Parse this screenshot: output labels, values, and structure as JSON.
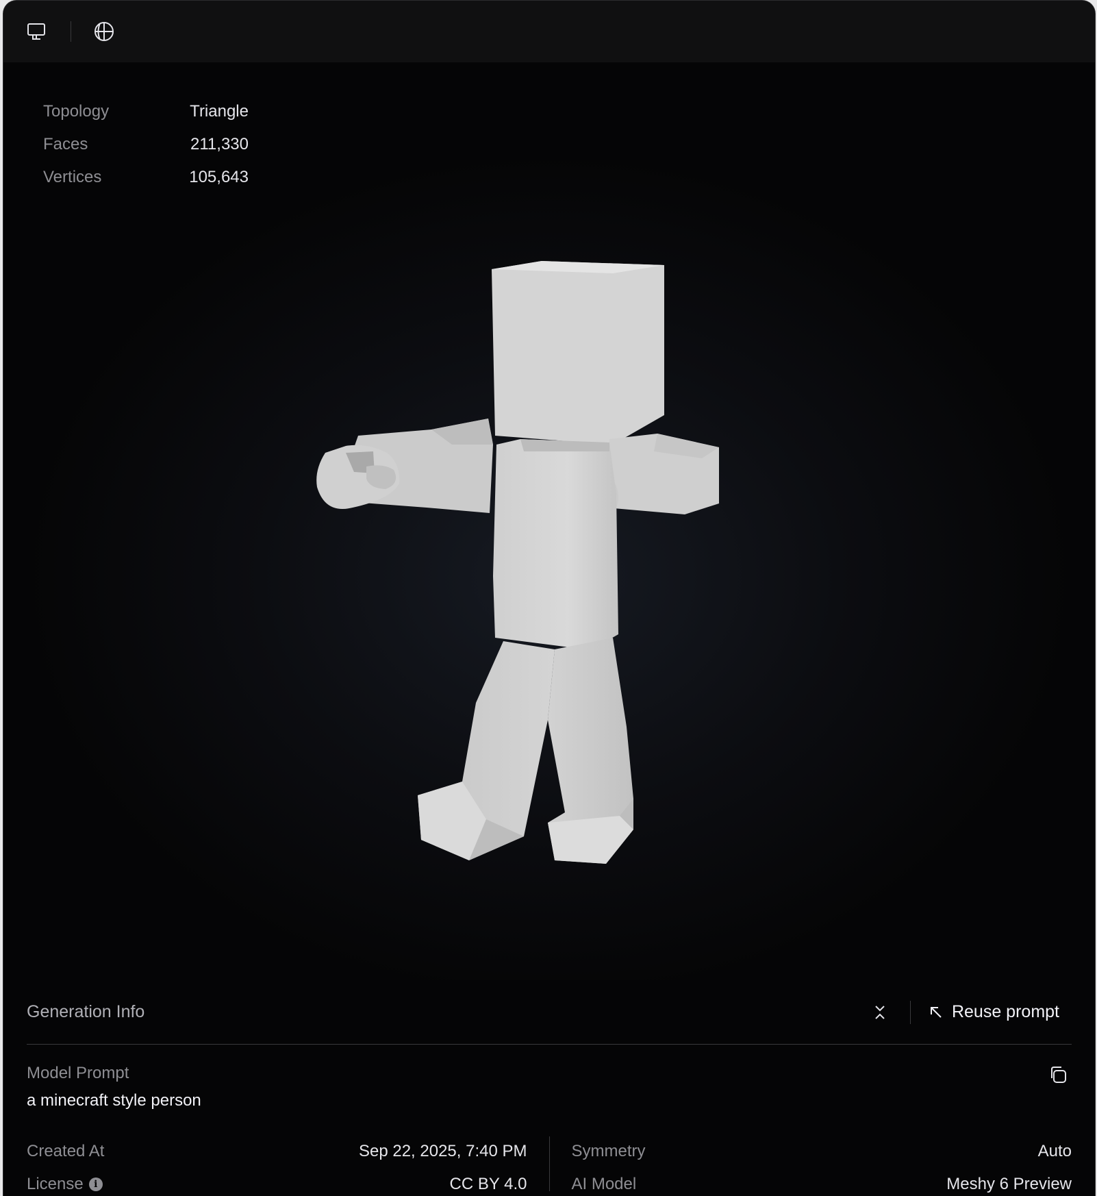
{
  "toolbar": {
    "icons": [
      "monitor-icon",
      "globe-icon"
    ]
  },
  "stats": {
    "topology_label": "Topology",
    "topology_value": "Triangle",
    "faces_label": "Faces",
    "faces_value": "211,330",
    "vertices_label": "Vertices",
    "vertices_value": "105,643"
  },
  "generation_info": {
    "title": "Generation Info",
    "reuse_prompt_label": "Reuse prompt",
    "model_prompt_label": "Model Prompt",
    "model_prompt_text": "a minecraft style person",
    "created_at_label": "Created At",
    "created_at_value": "Sep 22, 2025, 7:40 PM",
    "license_label": "License",
    "license_value": "CC BY 4.0",
    "symmetry_label": "Symmetry",
    "symmetry_value": "Auto",
    "ai_model_label": "AI Model",
    "ai_model_value": "Meshy 6 Preview"
  },
  "colors": {
    "background": "#050506",
    "toolbar": "#101011",
    "model": "#d6d6d6"
  }
}
